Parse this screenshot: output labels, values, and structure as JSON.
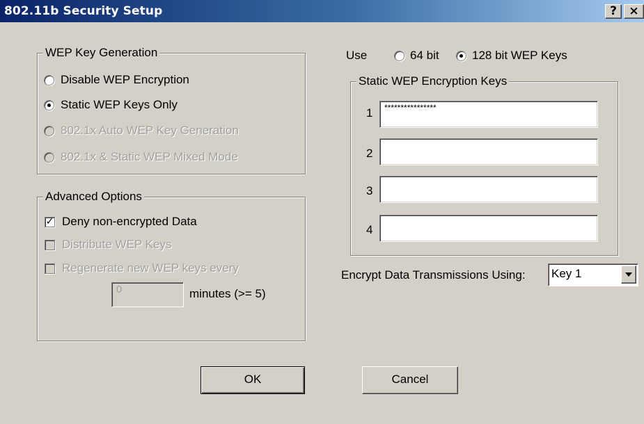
{
  "window": {
    "title": "802.11b Security Setup",
    "help_label": "?",
    "close_label": "×"
  },
  "wep_generation": {
    "legend": "WEP Key Generation",
    "options": [
      {
        "label": "Disable WEP Encryption",
        "selected": false,
        "enabled": true
      },
      {
        "label": "Static WEP Keys Only",
        "selected": true,
        "enabled": true
      },
      {
        "label": "802.1x Auto WEP Key Generation",
        "selected": false,
        "enabled": false
      },
      {
        "label": "802.1x & Static WEP Mixed Mode",
        "selected": false,
        "enabled": false
      }
    ]
  },
  "advanced": {
    "legend": "Advanced Options",
    "options": [
      {
        "label": "Deny non-encrypted Data",
        "checked": true,
        "enabled": true
      },
      {
        "label": "Distribute WEP Keys",
        "checked": false,
        "enabled": false
      },
      {
        "label": "Regenerate new WEP keys every",
        "checked": false,
        "enabled": false
      }
    ],
    "minutes_value": "0",
    "minutes_label": "minutes (>= 5)"
  },
  "key_size": {
    "use_label": "Use",
    "options": [
      {
        "label": "64 bit",
        "selected": false
      },
      {
        "label": "128 bit WEP Keys",
        "selected": true
      }
    ]
  },
  "static_keys": {
    "legend": "Static WEP Encryption Keys",
    "keys": [
      {
        "num": "1",
        "value": "****************"
      },
      {
        "num": "2",
        "value": ""
      },
      {
        "num": "3",
        "value": ""
      },
      {
        "num": "4",
        "value": ""
      }
    ]
  },
  "encrypt": {
    "label": "Encrypt Data Transmissions Using:",
    "selected": "Key 1"
  },
  "buttons": {
    "ok": "OK",
    "cancel": "Cancel"
  }
}
